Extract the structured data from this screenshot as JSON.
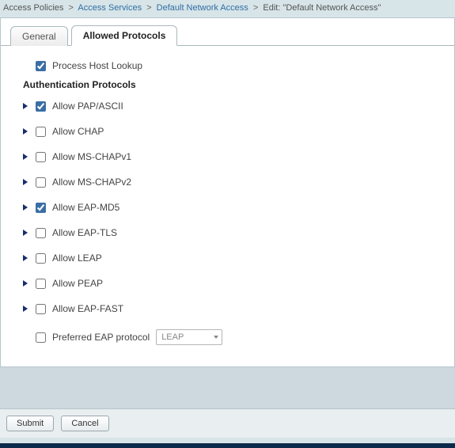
{
  "breadcrumb": {
    "root": "Access Policies",
    "link1": "Access Services",
    "link2": "Default Network Access",
    "current": "Edit: \"Default Network Access\""
  },
  "tabs": {
    "general": "General",
    "allowed": "Allowed Protocols"
  },
  "process_host_lookup": {
    "label": "Process Host Lookup",
    "checked": true
  },
  "section_title": "Authentication Protocols",
  "protocols": {
    "pap": {
      "label": "Allow PAP/ASCII",
      "checked": true
    },
    "chap": {
      "label": "Allow CHAP",
      "checked": false
    },
    "mschapv1": {
      "label": "Allow MS-CHAPv1",
      "checked": false
    },
    "mschapv2": {
      "label": "Allow MS-CHAPv2",
      "checked": false
    },
    "eapmd5": {
      "label": "Allow EAP-MD5",
      "checked": true
    },
    "eaptls": {
      "label": "Allow EAP-TLS",
      "checked": false
    },
    "leap": {
      "label": "Allow LEAP",
      "checked": false
    },
    "peap": {
      "label": "Allow PEAP",
      "checked": false
    },
    "eapfast": {
      "label": "Allow EAP-FAST",
      "checked": false
    }
  },
  "preferred_eap": {
    "label": "Preferred EAP protocol",
    "checked": false,
    "value": "LEAP"
  },
  "buttons": {
    "submit": "Submit",
    "cancel": "Cancel"
  }
}
